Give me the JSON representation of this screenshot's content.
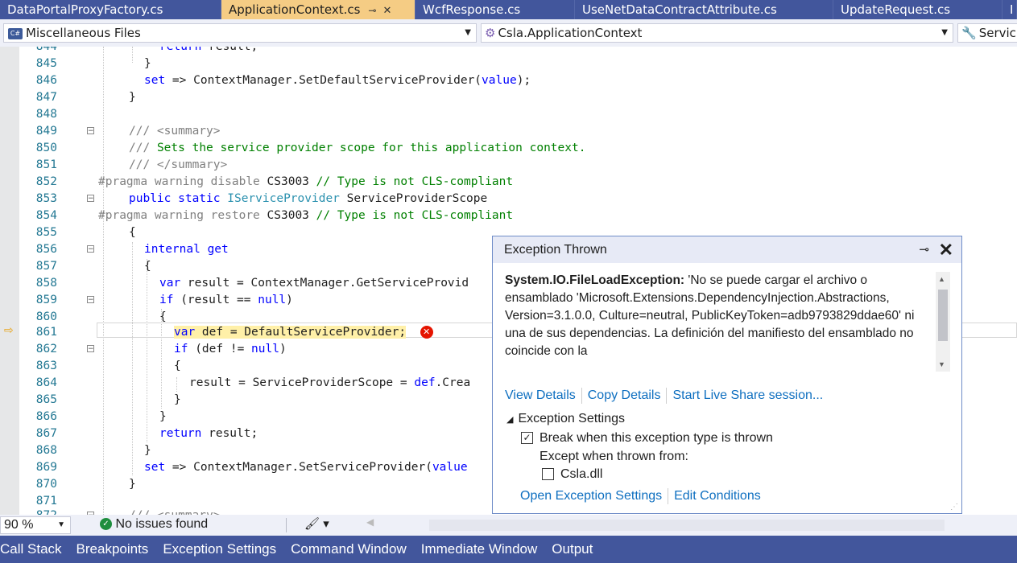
{
  "tabs": [
    {
      "label": "DataPortalProxyFactory.cs",
      "active": false
    },
    {
      "label": "ApplicationContext.cs",
      "active": true
    },
    {
      "label": "WcfResponse.cs",
      "active": false
    },
    {
      "label": "UseNetDataContractAttribute.cs",
      "active": false
    },
    {
      "label": "UpdateRequest.cs",
      "active": false
    }
  ],
  "navigation": {
    "project": "Miscellaneous Files",
    "type": "Csla.ApplicationContext",
    "member": "Servic"
  },
  "code_lines": [
    {
      "n": "844",
      "t": "return result;"
    },
    {
      "n": "845",
      "t": "}"
    },
    {
      "n": "846",
      "t": "set => ContextManager.SetDefaultServiceProvider(value);"
    },
    {
      "n": "847",
      "t": "}"
    },
    {
      "n": "848",
      "t": ""
    },
    {
      "n": "849",
      "t": "/// <summary>"
    },
    {
      "n": "850",
      "t": "/// Sets the service provider scope for this application context."
    },
    {
      "n": "851",
      "t": "/// </summary>"
    },
    {
      "n": "852",
      "t": "#pragma warning disable CS3003 // Type is not CLS-compliant"
    },
    {
      "n": "853",
      "t": "public static IServiceProvider ServiceProviderScope"
    },
    {
      "n": "854",
      "t": "#pragma warning restore CS3003 // Type is not CLS-compliant"
    },
    {
      "n": "855",
      "t": "{"
    },
    {
      "n": "856",
      "t": "internal get"
    },
    {
      "n": "857",
      "t": "{"
    },
    {
      "n": "858",
      "t": "var result = ContextManager.GetServiceProvid"
    },
    {
      "n": "859",
      "t": "if (result == null)"
    },
    {
      "n": "860",
      "t": "{"
    },
    {
      "n": "861",
      "t": "var def = DefaultServiceProvider;"
    },
    {
      "n": "862",
      "t": "if (def != null)"
    },
    {
      "n": "863",
      "t": "{"
    },
    {
      "n": "864",
      "t": "result = ServiceProviderScope = def.Crea"
    },
    {
      "n": "865",
      "t": "}"
    },
    {
      "n": "866",
      "t": "}"
    },
    {
      "n": "867",
      "t": "return result;"
    },
    {
      "n": "868",
      "t": "}"
    },
    {
      "n": "869",
      "t": "set => ContextManager.SetServiceProvider(value"
    },
    {
      "n": "870",
      "t": "}"
    },
    {
      "n": "871",
      "t": ""
    },
    {
      "n": "872",
      "t": "/// <summary>"
    }
  ],
  "exception_popup": {
    "title": "Exception Thrown",
    "exception_type": "System.IO.FileLoadException:",
    "message": " 'No se puede cargar el archivo o ensamblado 'Microsoft.Extensions.DependencyInjection.Abstractions, Version=3.1.0.0, Culture=neutral, PublicKeyToken=adb9793829ddae60' ni una de sus dependencias. La definición del manifiesto del ensamblado no coincide con la",
    "links": [
      "View Details",
      "Copy Details",
      "Start Live Share session..."
    ],
    "settings_title": "Exception Settings",
    "break_label": "Break when this exception type is thrown",
    "break_checked": true,
    "except_label": "Except when thrown from:",
    "csla_label": "Csla.dll",
    "csla_checked": false,
    "open_settings": "Open Exception Settings",
    "edit_conditions": "Edit Conditions"
  },
  "status": {
    "zoom": "90 %",
    "issues": "No issues found"
  },
  "bottom_tabs": [
    "Call Stack",
    "Breakpoints",
    "Exception Settings",
    "Command Window",
    "Immediate Window",
    "Output"
  ],
  "colors": {
    "accent": "#42569c",
    "active_tab": "#f5cc84",
    "keyword": "#0000ff",
    "comment": "#008000",
    "type": "#2b91af",
    "line_number": "#237893",
    "link": "#0e6fc0",
    "error": "#e51400"
  }
}
